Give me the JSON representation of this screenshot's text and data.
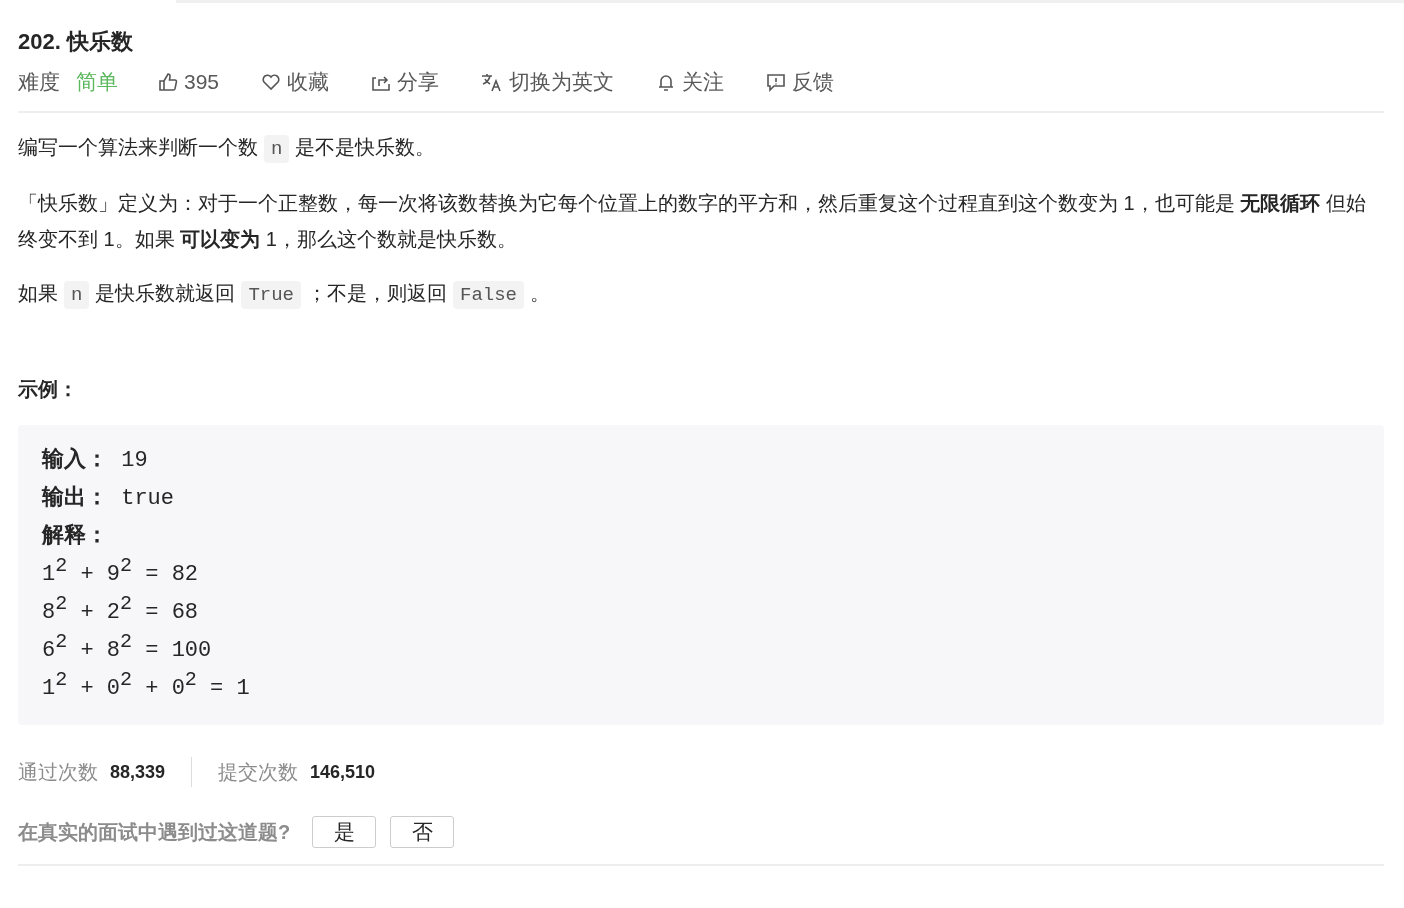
{
  "title": "202. 快乐数",
  "meta": {
    "difficulty_label": "难度",
    "difficulty": "简单",
    "actions": [
      {
        "kind": "like",
        "label": "395"
      },
      {
        "kind": "favorite",
        "label": "收藏"
      },
      {
        "kind": "share",
        "label": "分享"
      },
      {
        "kind": "translate",
        "label": "切换为英文"
      },
      {
        "kind": "follow",
        "label": "关注"
      },
      {
        "kind": "feedback",
        "label": "反馈"
      }
    ]
  },
  "description": [
    [
      {
        "kind": "text",
        "text": "编写一个算法来判断一个数"
      },
      {
        "kind": "code",
        "text": "n"
      },
      {
        "kind": "text",
        "text": "是不是快乐数。"
      }
    ],
    [
      {
        "kind": "text",
        "text": "「快乐数」定义为：对于一个正整数，每一次将该数替换为它每个位置上的数字的平方和，然后重复这个过程直到这个数变为 1，也可能是 **无限循环** 但始终变不到 1。如果 **可以变为**  1，那么这个数就是快乐数。"
      }
    ],
    [
      {
        "kind": "text",
        "text": "如果"
      },
      {
        "kind": "code",
        "text": "n"
      },
      {
        "kind": "text",
        "text": "是快乐数就返回"
      },
      {
        "kind": "code",
        "text": "True"
      },
      {
        "kind": "text",
        "text": "；不是，则返回"
      },
      {
        "kind": "code",
        "text": "False"
      },
      {
        "kind": "text",
        "text": "。"
      }
    ]
  ],
  "example": {
    "heading": "示例：",
    "lines": [
      "**输入：** 19",
      "**输出：** true",
      "**解释：**",
      "1$^{2}$ + 9$^{2}$ = 82",
      "8$^{2}$ + 2$^{2}$ = 68",
      "6$^{2}$ + 8$^{2}$ = 100",
      "1$^{2}$ + 0$^{2}$ + 0$^{2}$ = 1"
    ]
  },
  "stats": [
    {
      "label": "通过次数",
      "value": "88,339"
    },
    {
      "label": "提交次数",
      "value": "146,510"
    }
  ],
  "interview": {
    "question": "在真实的面试中遇到过这道题?",
    "buttons": [
      "是",
      "否"
    ]
  }
}
